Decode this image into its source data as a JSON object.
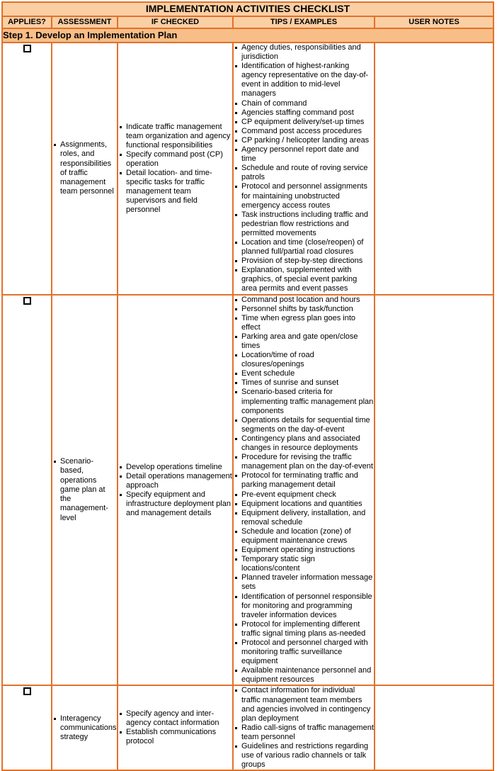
{
  "document": {
    "title": "IMPLEMENTATION ACTIVITIES CHECKLIST",
    "accent_color": "#E2712A",
    "title_bg": "#FBCFA4",
    "header_bg": "#FBCFA4",
    "step_bg": "#F8BE87"
  },
  "columns": {
    "applies": "APPLIES?",
    "assessment": "ASSESSMENT",
    "if_checked": "IF CHECKED",
    "tips": "TIPS / EXAMPLES",
    "notes": "USER NOTES"
  },
  "step": {
    "label": "Step 1. Develop an Implementation Plan"
  },
  "rows": [
    {
      "checkbox_name": "applies-checkbox-row-1",
      "assessment": [
        "Assignments, roles, and responsibilities of traffic management team personnel"
      ],
      "if_checked": [
        "Indicate traffic management team organization and agency functional responsibilities",
        "Specify command post (CP) operation",
        "Detail location- and time-specific tasks for traffic management team supervisors and field personnel"
      ],
      "tips": [
        "Agency duties, responsibilities and jurisdiction",
        "Identification of highest-ranking agency representative on the day-of-event in addition to mid-level managers",
        "Chain of command",
        "Agencies staffing command post",
        "CP equipment delivery/set-up times",
        "Command post access procedures",
        "CP parking / helicopter landing areas",
        "Agency personnel report date and time",
        "Schedule and route of roving service patrols",
        "Protocol and personnel assignments for maintaining unobstructed emergency access routes",
        "Task instructions including traffic and pedestrian flow restrictions and permitted movements",
        "Location and time (close/reopen) of planned full/partial road closures",
        "Provision of step-by-step directions",
        "Explanation, supplemented with graphics, of special event parking area permits and event passes"
      ],
      "notes": ""
    },
    {
      "checkbox_name": "applies-checkbox-row-2",
      "assessment": [
        "Scenario-based, operations game plan at the management-level"
      ],
      "if_checked": [
        "Develop operations timeline",
        "Detail operations management approach",
        "Specify equipment and infrastructure deployment plan and management details"
      ],
      "tips": [
        "Command post location and hours",
        "Personnel shifts by task/function",
        "Time when egress plan goes into effect",
        "Parking area and gate open/close times",
        "Location/time of road closures/openings",
        "Event schedule",
        "Times of sunrise and sunset",
        "Scenario-based criteria for implementing traffic management plan components",
        "Operations details for sequential time segments on the day-of-event",
        "Contingency plans and associated changes in resource deployments",
        "Procedure for revising the traffic management plan on the day-of-event",
        "Protocol for terminating traffic and parking management detail",
        "Pre-event equipment check",
        "Equipment locations and quantities",
        "Equipment delivery, installation, and removal schedule",
        "Schedule and location (zone) of equipment maintenance crews",
        "Equipment operating instructions",
        "Temporary static sign locations/content",
        "Planned traveler information message sets",
        "Identification of personnel responsible for monitoring and programming traveler information devices",
        "Protocol for implementing different traffic signal timing plans as-needed",
        "Protocol and personnel charged with monitoring traffic surveillance equipment",
        "Available maintenance personnel and equipment resources"
      ],
      "notes": ""
    },
    {
      "checkbox_name": "applies-checkbox-row-3",
      "assessment": [
        "Interagency communications strategy"
      ],
      "if_checked": [
        "Specify agency and inter-agency contact information",
        "Establish communications protocol"
      ],
      "tips": [
        "Contact information for individual traffic management team members and agencies involved in contingency plan deployment",
        "Radio call-signs of traffic management team personnel",
        "Guidelines and restrictions regarding use of various radio channels or talk groups"
      ],
      "notes": ""
    }
  ]
}
